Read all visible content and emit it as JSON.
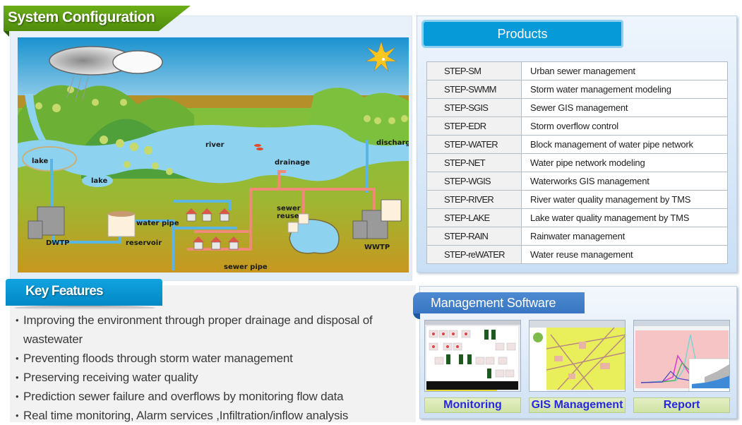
{
  "system_configuration": {
    "title": "System Configuration",
    "diagram_labels": {
      "river": "river",
      "lake_upper": "lake",
      "lake_lower": "lake",
      "drainage": "drainage",
      "discharge": "discharge",
      "water_pipe": "water pipe",
      "reservoir": "reservoir",
      "dwtp": "DWTP",
      "sewer_reuse_1": "sewer",
      "sewer_reuse_2": "reuse",
      "wwtp": "WWTP",
      "sewer_pipe": "sewer pipe"
    },
    "colors": {
      "sky_top": "#1a92cf",
      "sky_bottom": "#d8eef8",
      "grass": "#7cbd3a",
      "water": "#8dd3ef",
      "soil": "#c49a22",
      "sewer_pipe": "#f08a78",
      "water_pipe": "#5ab4e4"
    }
  },
  "products": {
    "title": "Products",
    "rows": [
      {
        "code": "STEP-SM",
        "description": "Urban sewer management"
      },
      {
        "code": "STEP-SWMM",
        "description": "Storm water management modeling"
      },
      {
        "code": "STEP-SGIS",
        "description": "Sewer GIS management"
      },
      {
        "code": "STEP-EDR",
        "description": "Storm overflow control"
      },
      {
        "code": "STEP-WATER",
        "description": "Block management of water pipe network"
      },
      {
        "code": "STEP-NET",
        "description": "Water pipe network modeling"
      },
      {
        "code": "STEP-WGIS",
        "description": "Waterworks GIS management"
      },
      {
        "code": "STEP-RIVER",
        "description": "River water quality management by TMS"
      },
      {
        "code": "STEP-LAKE",
        "description": "Lake water quality management by TMS"
      },
      {
        "code": "STEP-RAIN",
        "description": "Rainwater management"
      },
      {
        "code": "STEP-reWATER",
        "description": "Water reuse management"
      }
    ]
  },
  "key_features": {
    "title": "Key Features",
    "items": [
      "Improving the environment through proper drainage and disposal of wastewater",
      "Preventing floods through storm water management",
      "Preserving receiving water quality",
      "Prediction sewer failure and overflows by monitoring flow data",
      "Real time monitoring, Alarm services ,Infiltration/inflow analysis"
    ]
  },
  "management_software": {
    "title": "Management Software",
    "items": [
      {
        "label": "Monitoring",
        "thumbnail": "monitoring-screenshot"
      },
      {
        "label": "GIS Management",
        "thumbnail": "gis-map-screenshot"
      },
      {
        "label": "Report",
        "thumbnail": "report-chart-screenshot"
      }
    ]
  }
}
